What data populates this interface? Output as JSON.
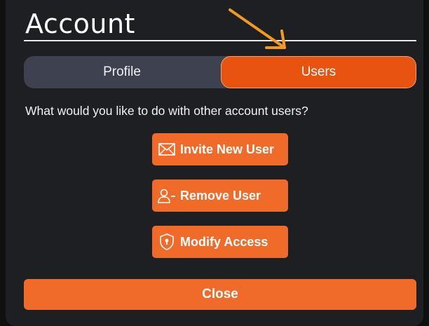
{
  "dialog": {
    "title": "Account"
  },
  "tabs": [
    {
      "label": "Profile",
      "active": false
    },
    {
      "label": "Users",
      "active": true
    }
  ],
  "users_panel": {
    "question": "What would you like to do with other account users?",
    "actions": [
      {
        "label": "Invite New User",
        "icon": "envelope-icon"
      },
      {
        "label": "Remove User",
        "icon": "user-minus-icon"
      },
      {
        "label": "Modify Access",
        "icon": "shield-lock-icon"
      }
    ]
  },
  "footer": {
    "close_label": "Close"
  },
  "annotation": {
    "arrow_color": "#f29a1f",
    "target": "Users tab"
  },
  "colors": {
    "accent": "#f06a2a",
    "active_tab": "#e8530f",
    "inactive_tab": "#3d4150",
    "dialog_bg": "#1d1f22"
  }
}
